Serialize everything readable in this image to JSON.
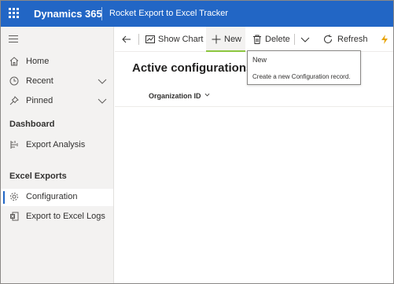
{
  "header": {
    "app_name": "Dynamics 365",
    "app_title": "Rocket Export to Excel Tracker"
  },
  "sidebar": {
    "items": [
      {
        "label": "Home",
        "icon": "home-icon"
      },
      {
        "label": "Recent",
        "icon": "clock-icon"
      },
      {
        "label": "Pinned",
        "icon": "pin-icon"
      }
    ],
    "groups": [
      {
        "title": "Dashboard",
        "items": [
          {
            "label": "Export Analysis",
            "icon": "dashboard-icon"
          }
        ]
      },
      {
        "title": "Excel Exports",
        "items": [
          {
            "label": "Configuration",
            "icon": "gear-icon",
            "selected": true
          },
          {
            "label": "Export to Excel Logs",
            "icon": "excel-icon"
          }
        ]
      }
    ]
  },
  "commandbar": {
    "show_chart": "Show Chart",
    "new": "New",
    "delete": "Delete",
    "refresh": "Refresh"
  },
  "main": {
    "view_title": "Active configurations",
    "column_header": "Organization ID"
  },
  "tooltip": {
    "title": "New",
    "description": "Create a new Configuration record."
  },
  "colors": {
    "header_bg": "#2266c5",
    "selection_accent": "#2266c5",
    "new_underline": "#8cc63f"
  }
}
